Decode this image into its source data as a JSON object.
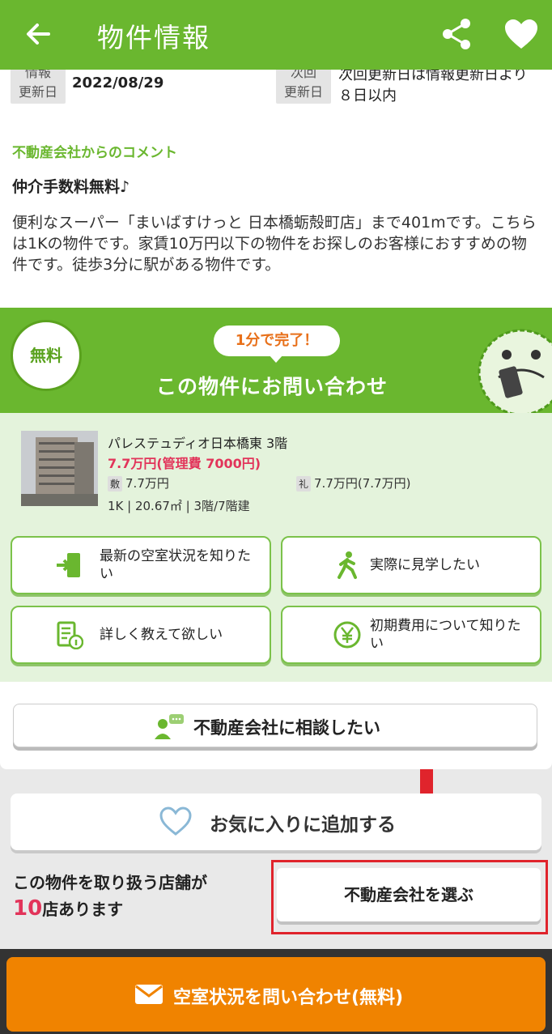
{
  "header": {
    "title": "物件情報"
  },
  "update_info": {
    "updated_label_1": "情報",
    "updated_label_2": "更新日",
    "updated_date": "2022/08/29",
    "next_label_1": "次回",
    "next_label_2": "更新日",
    "next_text": "次回更新日は情報更新日より８日以内"
  },
  "comment": {
    "label": "不動産会社からのコメント",
    "title": "仲介手数料無料♪",
    "body": "便利なスーパー「まいばすけっと 日本橋蛎殻町店」まで401mです。こちらは1Kの物件です。家賃10万円以下の物件をお探しのお客様におすすめの物件です。徒歩3分に駅がある物件です。"
  },
  "inquiry": {
    "free_badge": "無料",
    "bubble": "1分で完了！",
    "title": "この物件にお問い合わせ"
  },
  "property": {
    "name": "パレステュディオ日本橋東 3階",
    "price": "7.7万円(管理費 7000円)",
    "deposit_badge": "敷",
    "deposit": "7.7万円",
    "key_money_badge": "礼",
    "key_money": "7.7万円(7.7万円)",
    "spec": "1K | 20.67㎡ | 3階/7階建"
  },
  "options": [
    {
      "label": "最新の空室状況を知りたい",
      "icon": "door-exit-icon"
    },
    {
      "label": "実際に見学したい",
      "icon": "walking-person-icon"
    },
    {
      "label": "詳しく教えて欲しい",
      "icon": "document-info-icon"
    },
    {
      "label": "初期費用について知りたい",
      "icon": "yen-coin-icon"
    }
  ],
  "consult": {
    "label": "不動産会社に相談したい"
  },
  "favorite": {
    "label": "お気に入りに追加する"
  },
  "shops": {
    "text_1": "この物件を取り扱う店舗が",
    "count": "10",
    "text_2": "店あります",
    "choose_label": "不動産会社を選ぶ"
  },
  "cta": {
    "label": "空室状況を問い合わせ(無料)"
  },
  "colors": {
    "brand_green": "#6ab72f",
    "cta_orange": "#f08300",
    "price_red": "#e2345a",
    "highlight_red": "#e0242c"
  }
}
